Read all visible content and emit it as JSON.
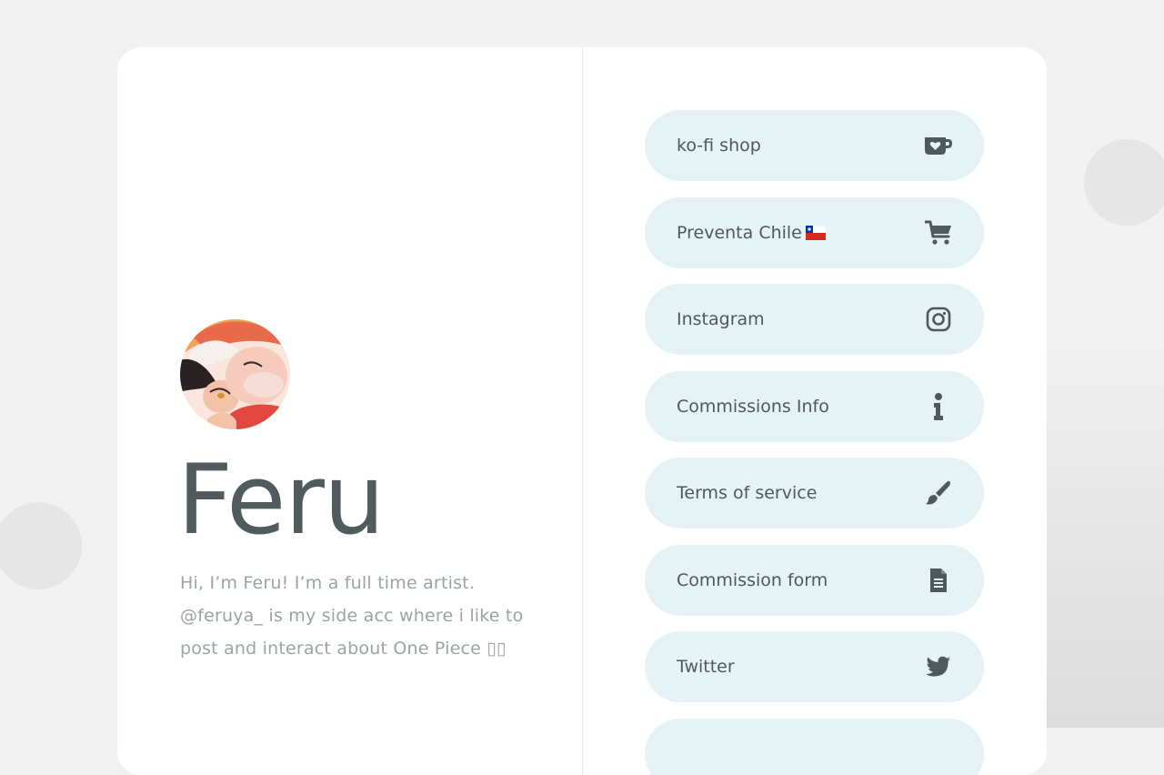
{
  "profile": {
    "name": "Feru",
    "bio": "Hi, I’m Feru! I’m a full time artist. @feruya_ is my side acc where i like to post and interact about One Piece ▯▯",
    "avatar": "avatar-illustration"
  },
  "links": [
    {
      "label": "ko-fi shop",
      "icon": "kofi-cup-icon"
    },
    {
      "label": "Preventa Chile",
      "icon": "shopping-cart-icon",
      "flag": "chile-flag-icon"
    },
    {
      "label": "Instagram",
      "icon": "instagram-icon"
    },
    {
      "label": "Commissions Info",
      "icon": "info-icon"
    },
    {
      "label": "Terms of service",
      "icon": "paintbrush-icon"
    },
    {
      "label": "Commission form",
      "icon": "document-icon"
    },
    {
      "label": "Twitter",
      "icon": "twitter-bird-icon"
    },
    {
      "label": "",
      "icon": ""
    }
  ],
  "colors": {
    "page_bg": "#f2f2f2",
    "card_bg": "#ffffff",
    "link_bg": "#e6f3f6",
    "text_dark": "#4f5b5d",
    "text_muted": "#9aa3a6",
    "flag_red": "#d52b1e",
    "flag_blue": "#0039a6"
  }
}
